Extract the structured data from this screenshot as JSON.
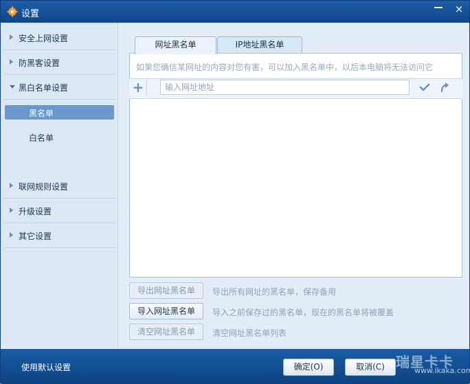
{
  "window": {
    "title": "设置",
    "minimize_icon": "minimize-icon",
    "close_icon": "close-icon",
    "close_label": "×"
  },
  "sidebar": {
    "items": [
      {
        "label": "安全上网设置",
        "icon": "chevron-right-icon"
      },
      {
        "label": "防黑客设置",
        "icon": "chevron-right-icon"
      },
      {
        "label": "黑白名单设置",
        "icon": "chevron-down-icon"
      },
      {
        "label": "联网规则设置",
        "icon": "chevron-right-icon"
      },
      {
        "label": "升级设置",
        "icon": "chevron-right-icon"
      },
      {
        "label": "其它设置",
        "icon": "chevron-right-icon"
      }
    ],
    "sub_items": [
      {
        "label": "黑名单"
      },
      {
        "label": "白名单"
      }
    ]
  },
  "tabs": [
    {
      "label": "网址黑名单"
    },
    {
      "label": "IP地址黑名单"
    }
  ],
  "main": {
    "hint": "如果您确信某网址的内容对您有害，可以加入黑名单中，以后本电脑将无法访问它",
    "input_placeholder": "输入网址地址",
    "add_icon": "plus-icon",
    "confirm_icon": "check-icon",
    "redo_icon": "redo-icon"
  },
  "actions": [
    {
      "button": "导出网址黑名单",
      "description": "导出所有网址的黑名单，保存备用",
      "enabled": false
    },
    {
      "button": "导入网址黑名单",
      "description": "导入之前保存过的黑名单，现在的黑名单将被覆盖",
      "enabled": true
    },
    {
      "button": "清空网址黑名单",
      "description": "清空网址黑名单列表",
      "enabled": false
    }
  ],
  "footer": {
    "default_settings": "使用默认设置",
    "ok": "确定(O)",
    "cancel": "取消(C)",
    "watermark_main": "瑞星卡卡",
    "watermark_sub": "www.ikaka.com"
  },
  "colors": {
    "titlebar": "#1d5fa8",
    "footer": "#1a5ca5",
    "selected_item": "#6a97cc"
  }
}
